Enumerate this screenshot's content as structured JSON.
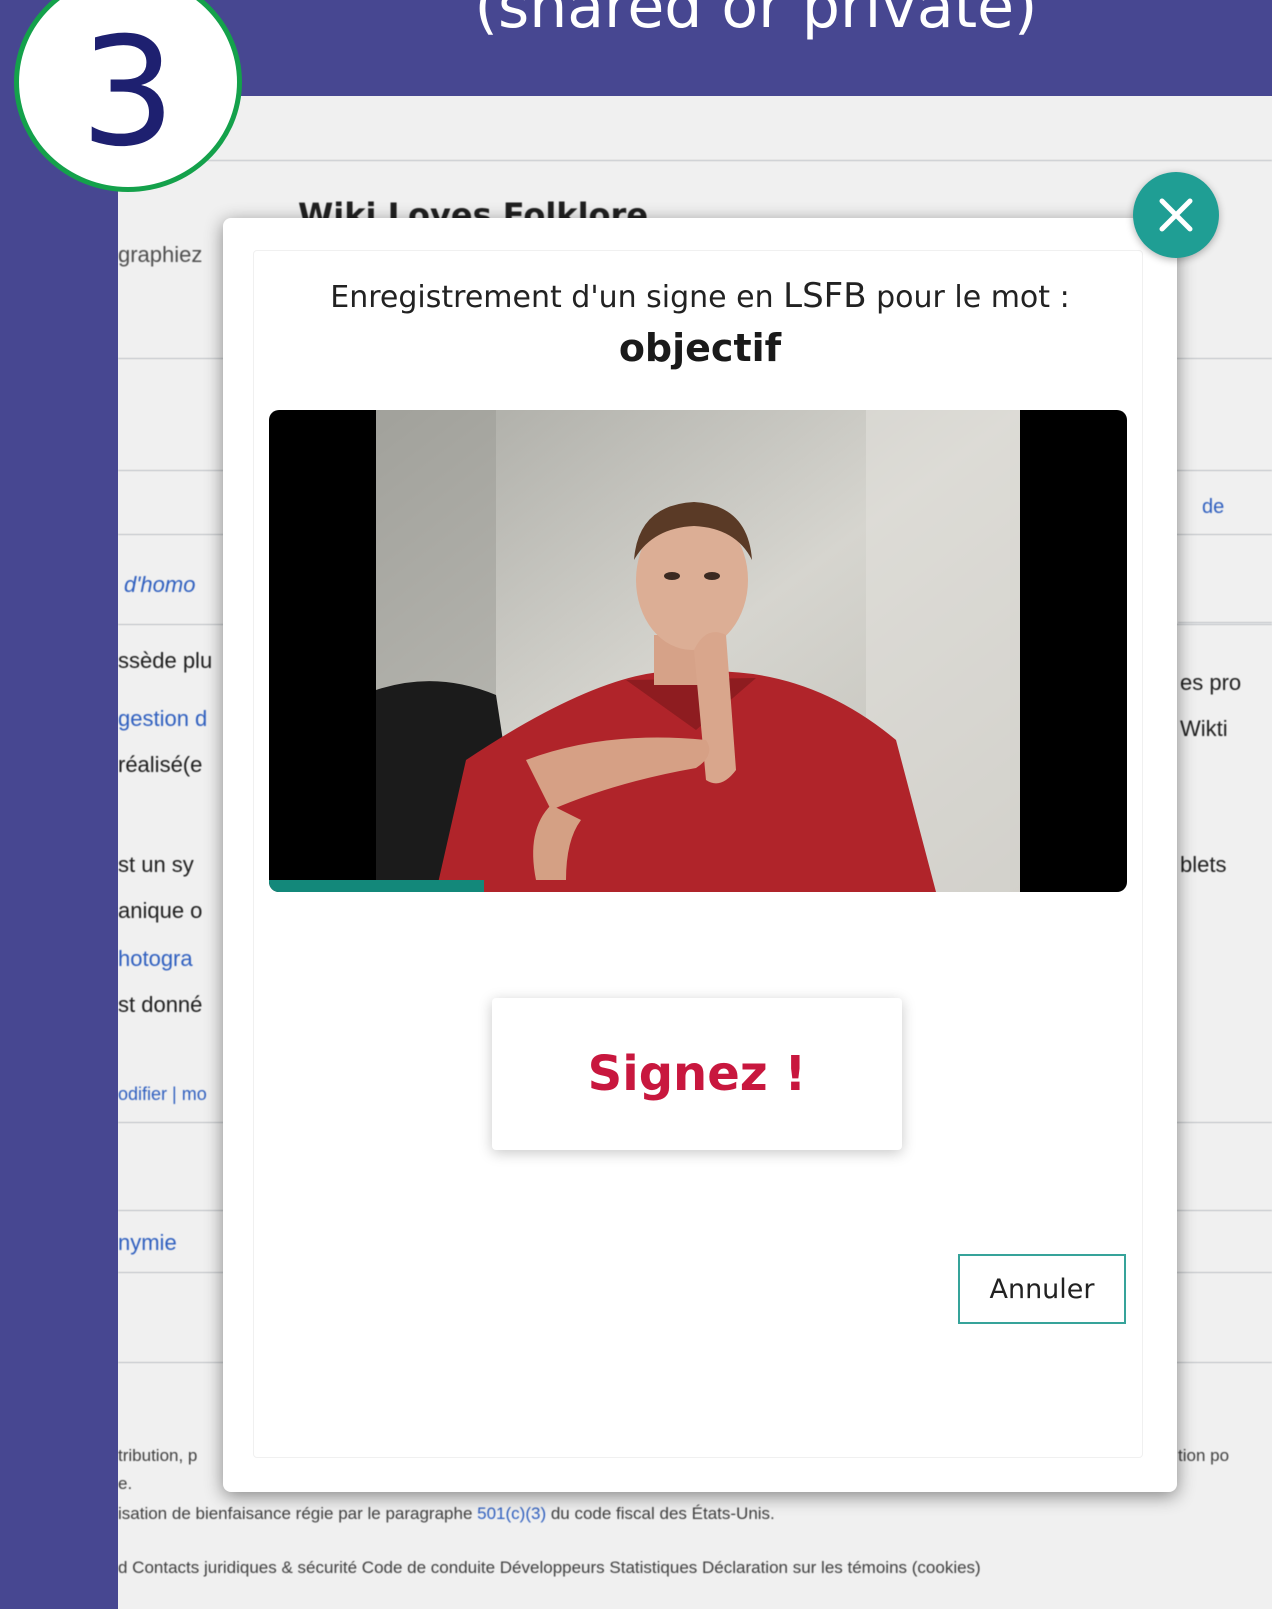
{
  "slide": {
    "title": "(shared or private)",
    "step_number": "3"
  },
  "page_bg": {
    "banner_title": "Wiki Loves Folklore",
    "banner_subtitle": "graphiez",
    "left_fragments": [
      "d'homo",
      "ssède plu",
      "gestion d",
      "réalisé(e",
      "st un sy",
      "anique o",
      "hotogra",
      "st donné",
      "odifier | mo",
      "nymie"
    ],
    "right_fragments": [
      "de",
      "es pro",
      "Wikti",
      "blets"
    ],
    "footer": {
      "line1": "tribution, p",
      "line1_right": "tion po",
      "line2": "e.",
      "line3_pre": "isation de bienfaisance régie par le paragraphe ",
      "line3_link": "501(c)(3)",
      "line3_post": " du code fiscal des États-Unis.",
      "line4": "d    Contacts juridiques & sécurité    Code de conduite    Développeurs    Statistiques    Déclaration sur les témoins (cookies)"
    }
  },
  "modal": {
    "prompt_prefix": "Enregistrement d'un signe en ",
    "language": "LSFB",
    "prompt_suffix": " pour le mot :",
    "word": "objectif",
    "record_progress": 0.25,
    "sign_button_label": "Signez !",
    "cancel_button_label": "Annuler",
    "close_icon": "close-icon"
  },
  "colors": {
    "slide_bg": "#474791",
    "step_circle_border": "#14a14b",
    "step_number": "#1e2070",
    "accent_teal": "#1f9e94",
    "sign_text": "#c8173e"
  }
}
